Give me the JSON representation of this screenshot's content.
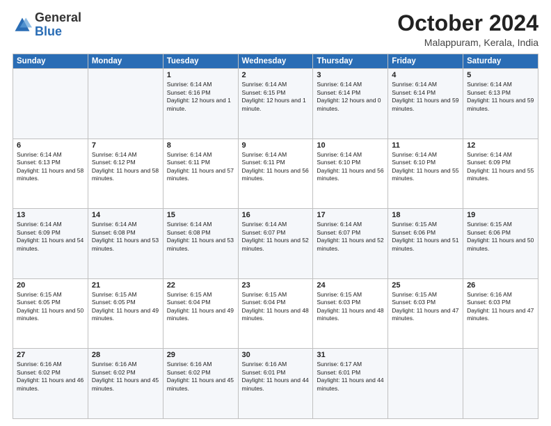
{
  "logo": {
    "general": "General",
    "blue": "Blue"
  },
  "header": {
    "month_title": "October 2024",
    "location": "Malappuram, Kerala, India"
  },
  "days_of_week": [
    "Sunday",
    "Monday",
    "Tuesday",
    "Wednesday",
    "Thursday",
    "Friday",
    "Saturday"
  ],
  "weeks": [
    [
      {
        "day": "",
        "sunrise": "",
        "sunset": "",
        "daylight": ""
      },
      {
        "day": "",
        "sunrise": "",
        "sunset": "",
        "daylight": ""
      },
      {
        "day": "1",
        "sunrise": "Sunrise: 6:14 AM",
        "sunset": "Sunset: 6:16 PM",
        "daylight": "Daylight: 12 hours and 1 minute."
      },
      {
        "day": "2",
        "sunrise": "Sunrise: 6:14 AM",
        "sunset": "Sunset: 6:15 PM",
        "daylight": "Daylight: 12 hours and 1 minute."
      },
      {
        "day": "3",
        "sunrise": "Sunrise: 6:14 AM",
        "sunset": "Sunset: 6:14 PM",
        "daylight": "Daylight: 12 hours and 0 minutes."
      },
      {
        "day": "4",
        "sunrise": "Sunrise: 6:14 AM",
        "sunset": "Sunset: 6:14 PM",
        "daylight": "Daylight: 11 hours and 59 minutes."
      },
      {
        "day": "5",
        "sunrise": "Sunrise: 6:14 AM",
        "sunset": "Sunset: 6:13 PM",
        "daylight": "Daylight: 11 hours and 59 minutes."
      }
    ],
    [
      {
        "day": "6",
        "sunrise": "Sunrise: 6:14 AM",
        "sunset": "Sunset: 6:13 PM",
        "daylight": "Daylight: 11 hours and 58 minutes."
      },
      {
        "day": "7",
        "sunrise": "Sunrise: 6:14 AM",
        "sunset": "Sunset: 6:12 PM",
        "daylight": "Daylight: 11 hours and 58 minutes."
      },
      {
        "day": "8",
        "sunrise": "Sunrise: 6:14 AM",
        "sunset": "Sunset: 6:11 PM",
        "daylight": "Daylight: 11 hours and 57 minutes."
      },
      {
        "day": "9",
        "sunrise": "Sunrise: 6:14 AM",
        "sunset": "Sunset: 6:11 PM",
        "daylight": "Daylight: 11 hours and 56 minutes."
      },
      {
        "day": "10",
        "sunrise": "Sunrise: 6:14 AM",
        "sunset": "Sunset: 6:10 PM",
        "daylight": "Daylight: 11 hours and 56 minutes."
      },
      {
        "day": "11",
        "sunrise": "Sunrise: 6:14 AM",
        "sunset": "Sunset: 6:10 PM",
        "daylight": "Daylight: 11 hours and 55 minutes."
      },
      {
        "day": "12",
        "sunrise": "Sunrise: 6:14 AM",
        "sunset": "Sunset: 6:09 PM",
        "daylight": "Daylight: 11 hours and 55 minutes."
      }
    ],
    [
      {
        "day": "13",
        "sunrise": "Sunrise: 6:14 AM",
        "sunset": "Sunset: 6:09 PM",
        "daylight": "Daylight: 11 hours and 54 minutes."
      },
      {
        "day": "14",
        "sunrise": "Sunrise: 6:14 AM",
        "sunset": "Sunset: 6:08 PM",
        "daylight": "Daylight: 11 hours and 53 minutes."
      },
      {
        "day": "15",
        "sunrise": "Sunrise: 6:14 AM",
        "sunset": "Sunset: 6:08 PM",
        "daylight": "Daylight: 11 hours and 53 minutes."
      },
      {
        "day": "16",
        "sunrise": "Sunrise: 6:14 AM",
        "sunset": "Sunset: 6:07 PM",
        "daylight": "Daylight: 11 hours and 52 minutes."
      },
      {
        "day": "17",
        "sunrise": "Sunrise: 6:14 AM",
        "sunset": "Sunset: 6:07 PM",
        "daylight": "Daylight: 11 hours and 52 minutes."
      },
      {
        "day": "18",
        "sunrise": "Sunrise: 6:15 AM",
        "sunset": "Sunset: 6:06 PM",
        "daylight": "Daylight: 11 hours and 51 minutes."
      },
      {
        "day": "19",
        "sunrise": "Sunrise: 6:15 AM",
        "sunset": "Sunset: 6:06 PM",
        "daylight": "Daylight: 11 hours and 50 minutes."
      }
    ],
    [
      {
        "day": "20",
        "sunrise": "Sunrise: 6:15 AM",
        "sunset": "Sunset: 6:05 PM",
        "daylight": "Daylight: 11 hours and 50 minutes."
      },
      {
        "day": "21",
        "sunrise": "Sunrise: 6:15 AM",
        "sunset": "Sunset: 6:05 PM",
        "daylight": "Daylight: 11 hours and 49 minutes."
      },
      {
        "day": "22",
        "sunrise": "Sunrise: 6:15 AM",
        "sunset": "Sunset: 6:04 PM",
        "daylight": "Daylight: 11 hours and 49 minutes."
      },
      {
        "day": "23",
        "sunrise": "Sunrise: 6:15 AM",
        "sunset": "Sunset: 6:04 PM",
        "daylight": "Daylight: 11 hours and 48 minutes."
      },
      {
        "day": "24",
        "sunrise": "Sunrise: 6:15 AM",
        "sunset": "Sunset: 6:03 PM",
        "daylight": "Daylight: 11 hours and 48 minutes."
      },
      {
        "day": "25",
        "sunrise": "Sunrise: 6:15 AM",
        "sunset": "Sunset: 6:03 PM",
        "daylight": "Daylight: 11 hours and 47 minutes."
      },
      {
        "day": "26",
        "sunrise": "Sunrise: 6:16 AM",
        "sunset": "Sunset: 6:03 PM",
        "daylight": "Daylight: 11 hours and 47 minutes."
      }
    ],
    [
      {
        "day": "27",
        "sunrise": "Sunrise: 6:16 AM",
        "sunset": "Sunset: 6:02 PM",
        "daylight": "Daylight: 11 hours and 46 minutes."
      },
      {
        "day": "28",
        "sunrise": "Sunrise: 6:16 AM",
        "sunset": "Sunset: 6:02 PM",
        "daylight": "Daylight: 11 hours and 45 minutes."
      },
      {
        "day": "29",
        "sunrise": "Sunrise: 6:16 AM",
        "sunset": "Sunset: 6:02 PM",
        "daylight": "Daylight: 11 hours and 45 minutes."
      },
      {
        "day": "30",
        "sunrise": "Sunrise: 6:16 AM",
        "sunset": "Sunset: 6:01 PM",
        "daylight": "Daylight: 11 hours and 44 minutes."
      },
      {
        "day": "31",
        "sunrise": "Sunrise: 6:17 AM",
        "sunset": "Sunset: 6:01 PM",
        "daylight": "Daylight: 11 hours and 44 minutes."
      },
      {
        "day": "",
        "sunrise": "",
        "sunset": "",
        "daylight": ""
      },
      {
        "day": "",
        "sunrise": "",
        "sunset": "",
        "daylight": ""
      }
    ]
  ]
}
